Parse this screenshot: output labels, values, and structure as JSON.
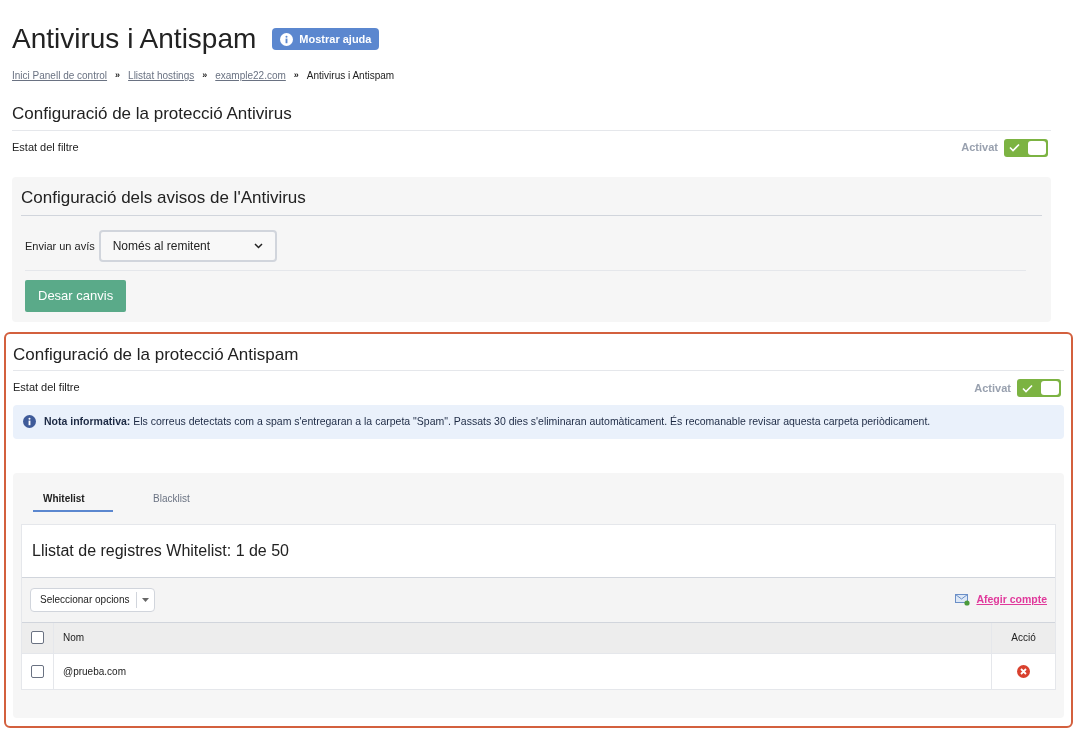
{
  "page": {
    "title": "Antivirus i Antispam",
    "help_button": "Mostrar ajuda"
  },
  "breadcrumb": [
    {
      "label": "Inici Panell de control",
      "current": false
    },
    {
      "separator": "»",
      "label": "Llistat hostings",
      "current": false
    },
    {
      "separator": "»",
      "label": "example22.com",
      "current": false
    },
    {
      "separator": "»",
      "label": "Antivirus i Antispam",
      "current": true
    }
  ],
  "antivirus": {
    "heading": "Configuració de la protecció Antivirus",
    "filter_label": "Estat del filtre",
    "toggle_label": "Activat",
    "on": true
  },
  "warnings": {
    "heading": "Configuració dels avisos de l'Antivirus",
    "field_label": "Enviar un avís",
    "select_value": "Només al remitent",
    "save_button": "Desar canvis"
  },
  "antispam": {
    "heading": "Configuració de la protecció Antispam",
    "filter_label": "Estat del filtre",
    "toggle_label": "Activat",
    "on": true,
    "note": "**Nota informativa:** Els correus detectats com a spam s'entregaran a la carpeta \"Spam\". Passats 30 dies s'eliminaran automàticament. És recomanable revisar aquesta carpeta periòdicament."
  },
  "tabs": [
    {
      "label": "Whitelist",
      "selected": true
    },
    {
      "label": "Blacklist",
      "selected": false
    }
  ],
  "list": {
    "title": "Llistat de registres Whitelist: 1 de 50",
    "options_button": "Seleccionar opcions",
    "add_link": "Afegir compte",
    "columns": [
      {
        "label": "Nom"
      },
      {
        "label": "Acció"
      }
    ],
    "header_checked": false,
    "rows": [
      {
        "name": "@prueba.com",
        "checked": false
      }
    ]
  }
}
